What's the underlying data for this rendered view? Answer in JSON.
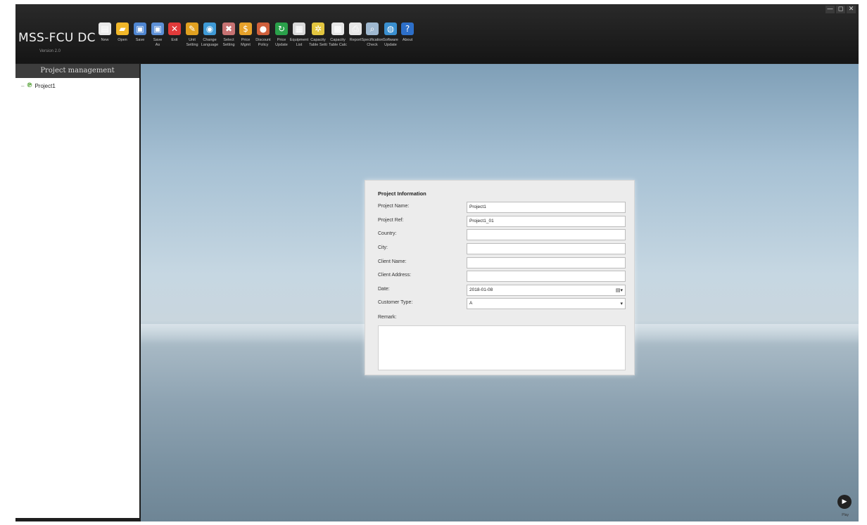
{
  "window": {
    "controls": [
      "—",
      "◻",
      "✕"
    ]
  },
  "brand": {
    "title": "MSS-FCU DC",
    "version": "Version 2.0"
  },
  "toolbar": {
    "tools": [
      {
        "label": "New",
        "icon": "new-file-icon",
        "color": "#e9e9e9",
        "glyph": "▤"
      },
      {
        "label": "Open",
        "icon": "open-folder-icon",
        "color": "#f1b729",
        "glyph": "▰"
      },
      {
        "label": "Save",
        "icon": "save-icon",
        "color": "#4f86d1",
        "glyph": "▣"
      },
      {
        "label": "Save\nAs",
        "icon": "save-as-icon",
        "color": "#5c8fd6",
        "glyph": "▣"
      },
      {
        "label": "Exit",
        "icon": "exit-icon",
        "color": "#e23a3a",
        "glyph": "✕"
      },
      {
        "label": "Unit\nSetting",
        "icon": "pencil-icon",
        "color": "#e0a020",
        "glyph": "✎"
      },
      {
        "label": "Change\nLanguage",
        "icon": "globe-icon",
        "color": "#3f9ad6",
        "glyph": "◉"
      },
      {
        "label": "Select\nSetting",
        "icon": "tools-icon",
        "color": "#c77272",
        "glyph": "✖"
      },
      {
        "label": "Price\nMgmt",
        "icon": "coin-icon",
        "color": "#e6a12a",
        "glyph": "$"
      },
      {
        "label": "Discount\nPolicy",
        "icon": "discount-icon",
        "color": "#d0603c",
        "glyph": "●"
      },
      {
        "label": "Price\nUpdate",
        "icon": "refresh-icon",
        "color": "#2aa04a",
        "glyph": "↻"
      },
      {
        "label": "Equipment\nList",
        "icon": "list-icon",
        "color": "#d9d9d9",
        "glyph": "▦"
      },
      {
        "label": "Capacity\nTable Setti",
        "icon": "gear-icon",
        "color": "#e3c640",
        "glyph": "✲"
      },
      {
        "label": "Capacity\nTable Calc",
        "icon": "excel-icon",
        "color": "#e6e6e6",
        "glyph": "▩"
      },
      {
        "label": "Report",
        "icon": "printer-icon",
        "color": "#e6e6e6",
        "glyph": "⎙"
      },
      {
        "label": "Specification\nCheck",
        "icon": "search-icon",
        "color": "#9fb8cf",
        "glyph": "⌕"
      },
      {
        "label": "Software\nUpdate",
        "icon": "software-update-icon",
        "color": "#3a8fcf",
        "glyph": "◍"
      },
      {
        "label": "About",
        "icon": "help-icon",
        "color": "#2d6fc9",
        "glyph": "?"
      }
    ]
  },
  "sidebar": {
    "header": "Project management",
    "tree": [
      {
        "label": "Project1",
        "icon": "project-tree-icon"
      }
    ]
  },
  "project_info": {
    "title": "Project Information",
    "fields": [
      {
        "label": "Project Name:",
        "value": "Project1"
      },
      {
        "label": "Project Ref:",
        "value": "Project1_01"
      },
      {
        "label": "Country:",
        "value": ""
      },
      {
        "label": "City:",
        "value": ""
      },
      {
        "label": "Client Name:",
        "value": ""
      },
      {
        "label": "Client Address:",
        "value": ""
      },
      {
        "label": "Date:",
        "value": "2018-01-08",
        "control": "date-picker",
        "glyph": "▤▾"
      },
      {
        "label": "Customer Type:",
        "value": "A",
        "control": "dropdown",
        "glyph": "▾"
      }
    ],
    "remark_label": "Remark:",
    "remark_value": ""
  },
  "main": {
    "play_label": "Play"
  }
}
